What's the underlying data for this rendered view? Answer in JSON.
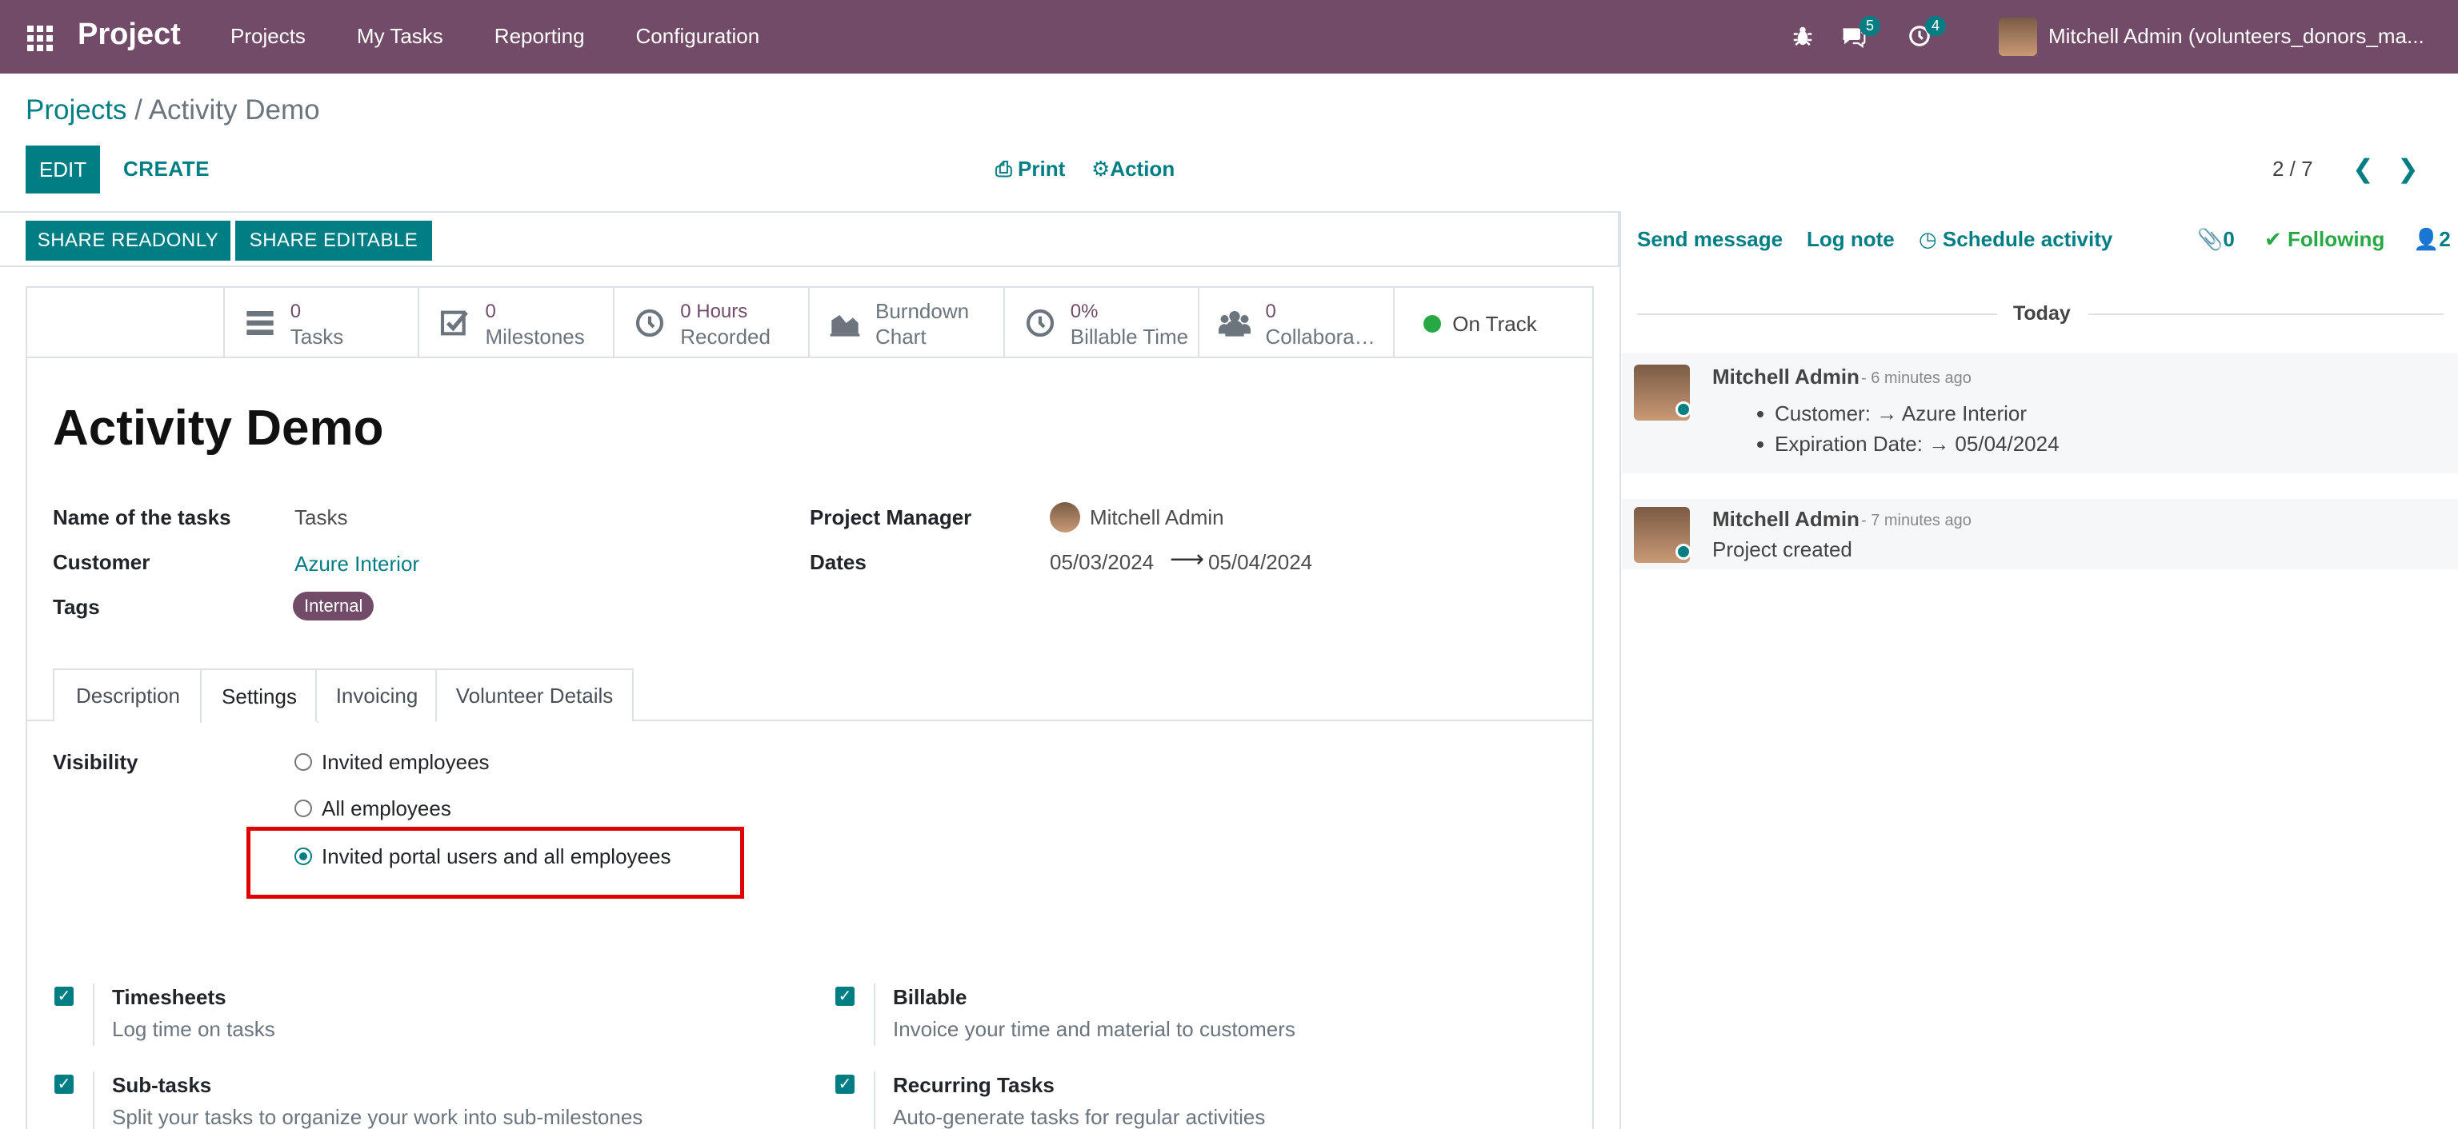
{
  "navbar": {
    "brand": "Project",
    "menu": [
      "Projects",
      "My Tasks",
      "Reporting",
      "Configuration"
    ],
    "messages_badge": "5",
    "activities_badge": "4",
    "user": "Mitchell Admin (volunteers_donors_ma..."
  },
  "control": {
    "breadcrumb_root": "Projects",
    "breadcrumb_sep": " / ",
    "breadcrumb_current": "Activity Demo",
    "edit": "EDIT",
    "create": "CREATE",
    "print": "Print",
    "action": "Action",
    "pager": "2 / 7"
  },
  "form": {
    "share_readonly": "SHARE READONLY",
    "share_editable": "SHARE EDITABLE",
    "stats": {
      "tasks_value": "0",
      "tasks_label": "Tasks",
      "milestones_value": "0",
      "milestones_label": "Milestones",
      "hours_value": "0 Hours",
      "hours_label": "Recorded",
      "burndown_line1": "Burndown",
      "burndown_line2": "Chart",
      "billable_value": "0%",
      "billable_label": "Billable Time",
      "collab_value": "0",
      "collab_label": "Collaborators",
      "status": "On Track"
    },
    "title": "Activity Demo",
    "fields": {
      "tasks_name_label": "Name of the tasks",
      "tasks_name_value": "Tasks",
      "customer_label": "Customer",
      "customer_value": "Azure Interior",
      "tags_label": "Tags",
      "tag_value": "Internal",
      "pm_label": "Project Manager",
      "pm_value": "Mitchell Admin",
      "dates_label": "Dates",
      "date_start": "05/03/2024",
      "date_end": "05/04/2024"
    },
    "tabs": [
      "Description",
      "Settings",
      "Invoicing",
      "Volunteer Details"
    ],
    "visibility_label": "Visibility",
    "visibility_options": [
      "Invited employees",
      "All employees",
      "Invited portal users and all employees"
    ],
    "visibility_selected": 2,
    "settings": {
      "timesheets_title": "Timesheets",
      "timesheets_desc": "Log time on tasks",
      "billable_title": "Billable",
      "billable_desc": "Invoice your time and material to customers",
      "subtasks_title": "Sub-tasks",
      "subtasks_desc": "Split your tasks to organize your work into sub-milestones",
      "recurring_title": "Recurring Tasks",
      "recurring_desc": "Auto-generate tasks for regular activities"
    }
  },
  "chatter": {
    "send_message": "Send message",
    "log_note": "Log note",
    "schedule_activity": "Schedule activity",
    "attachments": "0",
    "following": "Following",
    "followers": "2",
    "today": "Today",
    "messages": [
      {
        "author": "Mitchell Admin",
        "ago": "- 6 minutes ago",
        "changes": [
          "Customer: → Azure Interior",
          "Expiration Date: → 05/04/2024"
        ]
      },
      {
        "author": "Mitchell Admin",
        "ago": "- 7 minutes ago",
        "body": "Project created"
      }
    ]
  }
}
